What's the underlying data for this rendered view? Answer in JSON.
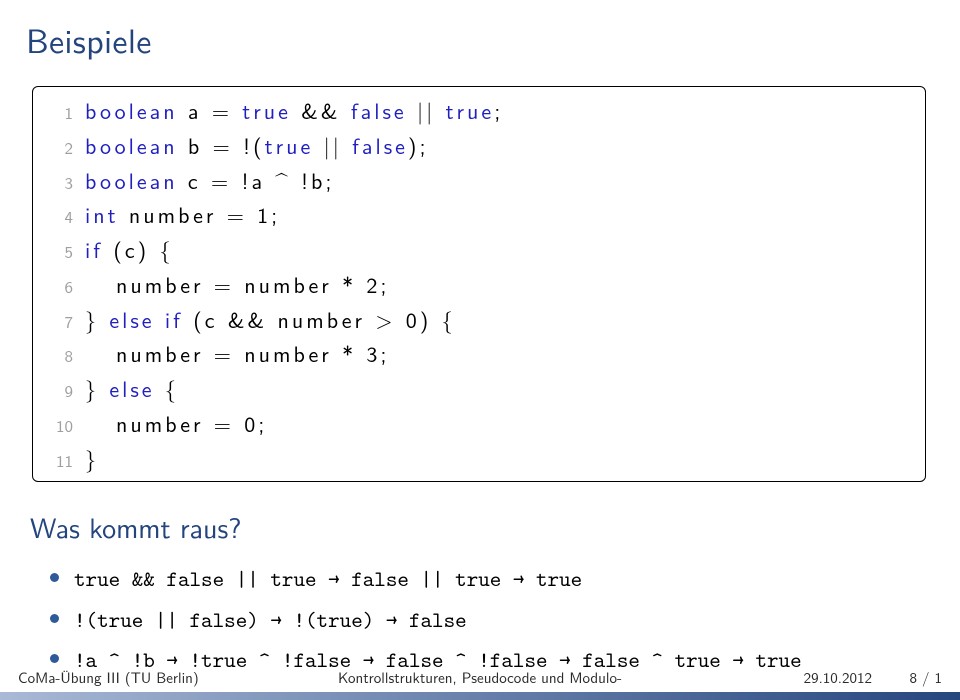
{
  "title": "Beispiele",
  "code": [
    {
      "n": "1",
      "pre": "",
      "p0": "boolean",
      "p1": " a = ",
      "p2": "true",
      "p3": " && ",
      "p4": "false",
      "p5": " || ",
      "p6": "true",
      "p7": ";"
    },
    {
      "n": "2",
      "pre": "",
      "p0": "boolean",
      "p1": " b = !(",
      "p2": "true",
      "p3": " || ",
      "p4": "false",
      "p5": ");",
      "p6": "",
      "p7": ""
    },
    {
      "n": "3",
      "pre": "",
      "p0": "boolean",
      "p1": " c = !a ^ !b;",
      "p2": "",
      "p3": "",
      "p4": "",
      "p5": "",
      "p6": "",
      "p7": ""
    },
    {
      "n": "4",
      "pre": "",
      "p0": "int",
      "p1": " number = 1;",
      "p2": "",
      "p3": "",
      "p4": "",
      "p5": "",
      "p6": "",
      "p7": ""
    },
    {
      "n": "5",
      "pre": "",
      "p0": "if",
      "p1": " (c) {",
      "p2": "",
      "p3": "",
      "p4": "",
      "p5": "",
      "p6": "",
      "p7": ""
    },
    {
      "n": "6",
      "pre": "   ",
      "p0": "",
      "p1": "number = number * 2;",
      "p2": "",
      "p3": "",
      "p4": "",
      "p5": "",
      "p6": "",
      "p7": ""
    },
    {
      "n": "7",
      "pre": "",
      "p0": "",
      "p1": "} ",
      "p2": "else if",
      "p3": " (c && number > 0) {",
      "p4": "",
      "p5": "",
      "p6": "",
      "p7": ""
    },
    {
      "n": "8",
      "pre": "   ",
      "p0": "",
      "p1": "number = number * 3;",
      "p2": "",
      "p3": "",
      "p4": "",
      "p5": "",
      "p6": "",
      "p7": ""
    },
    {
      "n": "9",
      "pre": "",
      "p0": "",
      "p1": "} ",
      "p2": "else",
      "p3": " {",
      "p4": "",
      "p5": "",
      "p6": "",
      "p7": ""
    },
    {
      "n": "10",
      "pre": "   ",
      "p0": "",
      "p1": "number = 0;",
      "p2": "",
      "p3": "",
      "p4": "",
      "p5": "",
      "p6": "",
      "p7": ""
    },
    {
      "n": "11",
      "pre": "",
      "p0": "",
      "p1": "}",
      "p2": "",
      "p3": "",
      "p4": "",
      "p5": "",
      "p6": "",
      "p7": ""
    }
  ],
  "heading2": "Was kommt raus?",
  "bullets": [
    {
      "text": "true && false || true → false || true → true"
    },
    {
      "text": "!(true || false) → !(true) → false"
    },
    {
      "text": "!a ^ !b → !true ^ !false → false ^ !false → false ^ true → true"
    }
  ],
  "footer": {
    "left": "CoMa-Übung III (TU Berlin)",
    "center": "Kontrollstrukturen, Pseudocode und Modulo-",
    "rightDate": "29.10.2012",
    "rightPage": "8 / 1"
  }
}
